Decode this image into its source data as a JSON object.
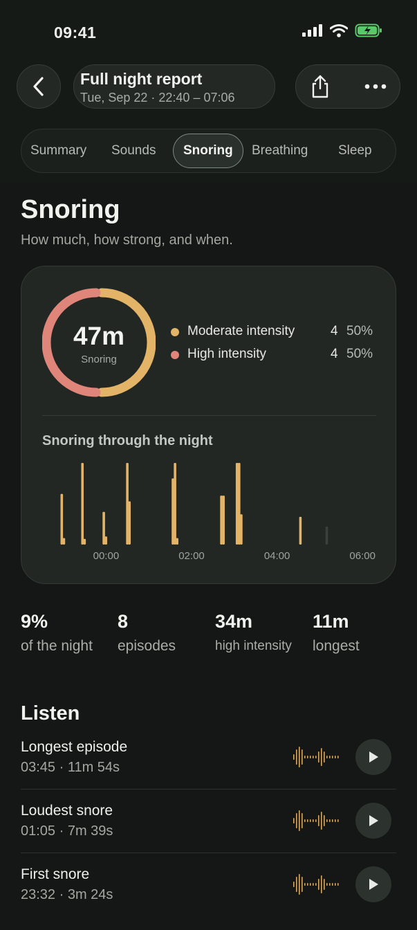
{
  "status_bar": {
    "time": "09:41"
  },
  "header": {
    "title": "Full night report",
    "subtitle": "Tue, Sep 22 · 22:40 – 07:06",
    "back_icon": "chevron-left-icon",
    "share_icon": "share-icon",
    "more_icon": "more-horizontal-icon"
  },
  "tabs": [
    {
      "label": "Summary"
    },
    {
      "label": "Sounds"
    },
    {
      "label": "Snoring",
      "active": true
    },
    {
      "label": "Breathing"
    },
    {
      "label": "Sleep"
    }
  ],
  "page": {
    "title": "Snoring",
    "subtitle": "How much, how strong, and when."
  },
  "summary_card": {
    "total": "47m",
    "total_label": "Snoring",
    "colors": {
      "moderate": "#e3b468",
      "high": "#e0857a"
    },
    "legend": [
      {
        "name": "Moderate intensity",
        "count": "4",
        "pct": "50%",
        "color": "#e3b468"
      },
      {
        "name": "High intensity",
        "count": "4",
        "pct": "50%",
        "color": "#e0857a"
      }
    ],
    "chart_title": "Snoring through the night"
  },
  "chart_data": {
    "type": "bar",
    "title": "Snoring through the night",
    "x_ticks": [
      "00:00",
      "02:00",
      "04:00",
      "06:00"
    ],
    "x_tick_minutes": [
      0,
      120,
      240,
      360
    ],
    "x_range_minutes": [
      -80,
      386
    ],
    "y_unit": "relative intensity",
    "ylim": [
      0,
      1
    ],
    "bar_color": "#e3b468",
    "bars": [
      {
        "t": -62,
        "v": 0.62
      },
      {
        "t": -59,
        "v": 0.08
      },
      {
        "t": -33,
        "v": 1.0
      },
      {
        "t": -30,
        "v": 0.07
      },
      {
        "t": -3,
        "v": 0.4
      },
      {
        "t": 0,
        "v": 0.1
      },
      {
        "t": 30,
        "v": 1.0
      },
      {
        "t": 33,
        "v": 0.53
      },
      {
        "t": 94,
        "v": 0.81
      },
      {
        "t": 97,
        "v": 1.0
      },
      {
        "t": 100,
        "v": 0.08
      },
      {
        "t": 162,
        "v": 0.6
      },
      {
        "t": 165,
        "v": 0.6
      },
      {
        "t": 184,
        "v": 1.0
      },
      {
        "t": 187,
        "v": 1.0
      },
      {
        "t": 190,
        "v": 0.37
      },
      {
        "t": 273,
        "v": 0.34
      },
      {
        "t": 310,
        "v": 0.22,
        "muted": true
      }
    ]
  },
  "stats": [
    {
      "value": "9%",
      "label": "of the night"
    },
    {
      "value": "8",
      "label": "episodes"
    },
    {
      "value": "34m",
      "label": "high intensity"
    },
    {
      "value": "11m",
      "label": "longest"
    }
  ],
  "listen": {
    "title": "Listen",
    "items": [
      {
        "title": "Longest episode",
        "meta": "03:45 · 11m 54s"
      },
      {
        "title": "Loudest snore",
        "meta": "01:05 · 7m 39s"
      },
      {
        "title": "First snore",
        "meta": "23:32 · 3m 24s"
      }
    ]
  }
}
